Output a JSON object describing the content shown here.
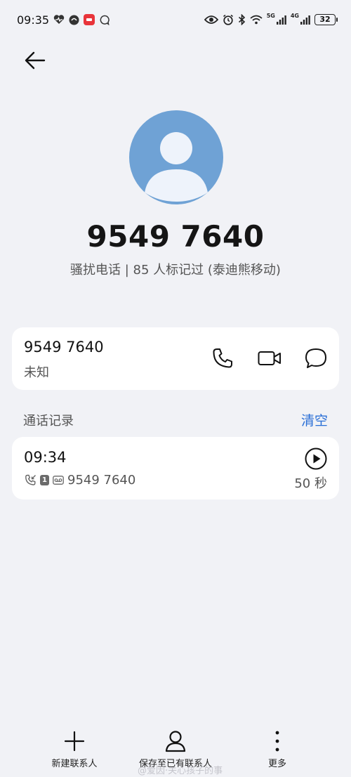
{
  "status_bar": {
    "time": "09:35",
    "network_1": "5G",
    "network_2": "4G",
    "battery": "32"
  },
  "caller": {
    "number": "9549 7640",
    "tag": "骚扰电话 | 85 人标记过 (泰迪熊移动)"
  },
  "contact_card": {
    "number": "9549 7640",
    "status": "未知"
  },
  "call_log": {
    "title": "通话记录",
    "clear_label": "清空",
    "entries": [
      {
        "time": "09:34",
        "sim": "1",
        "number": "9549 7640",
        "duration": "50 秒"
      }
    ]
  },
  "bottom_bar": {
    "new_contact": "新建联系人",
    "save_existing": "保存至已有联系人",
    "more": "更多"
  },
  "watermark": "@爱因·关心孩子的事",
  "colors": {
    "background": "#f1f2f6",
    "avatar": "#6fa2d5",
    "accent": "#2a6fd6"
  }
}
